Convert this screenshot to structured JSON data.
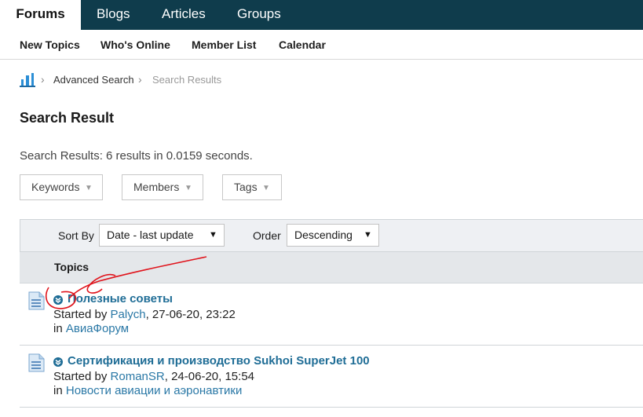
{
  "topnav": {
    "tabs": [
      {
        "label": "Forums",
        "active": true
      },
      {
        "label": "Blogs"
      },
      {
        "label": "Articles"
      },
      {
        "label": "Groups"
      }
    ]
  },
  "subnav": {
    "items": [
      {
        "label": "New Topics"
      },
      {
        "label": "Who's Online"
      },
      {
        "label": "Member List"
      },
      {
        "label": "Calendar"
      }
    ]
  },
  "breadcrumb": {
    "home_icon": "home-icon",
    "items": [
      {
        "label": "Advanced Search"
      },
      {
        "label": "Search Results"
      }
    ]
  },
  "page": {
    "title": "Search Result",
    "summary": "Search Results: 6 results in 0.0159 seconds."
  },
  "filters": {
    "keywords": "Keywords",
    "members": "Members",
    "tags": "Tags"
  },
  "sort": {
    "sort_label": "Sort By",
    "sort_value": "Date - last update",
    "order_label": "Order",
    "order_value": "Descending"
  },
  "table": {
    "header": "Topics",
    "rows": [
      {
        "title": "Полезные советы",
        "started_prefix": "Started by",
        "author": "Palych",
        "date": ", 27-06-20, 23:22",
        "in_prefix": "in",
        "forum": "АвиаФорум"
      },
      {
        "title": "Сертификация и производство Sukhoi SuperJet 100",
        "started_prefix": "Started by",
        "author": "RomanSR",
        "date": ", 24-06-20, 15:54",
        "in_prefix": "in",
        "forum": "Новости авиации и аэронавтики"
      }
    ]
  },
  "colors": {
    "nav_bg": "#0f3c4c",
    "link": "#2a78a6",
    "title_link": "#1f6d96",
    "annotation": "#e0141c"
  }
}
